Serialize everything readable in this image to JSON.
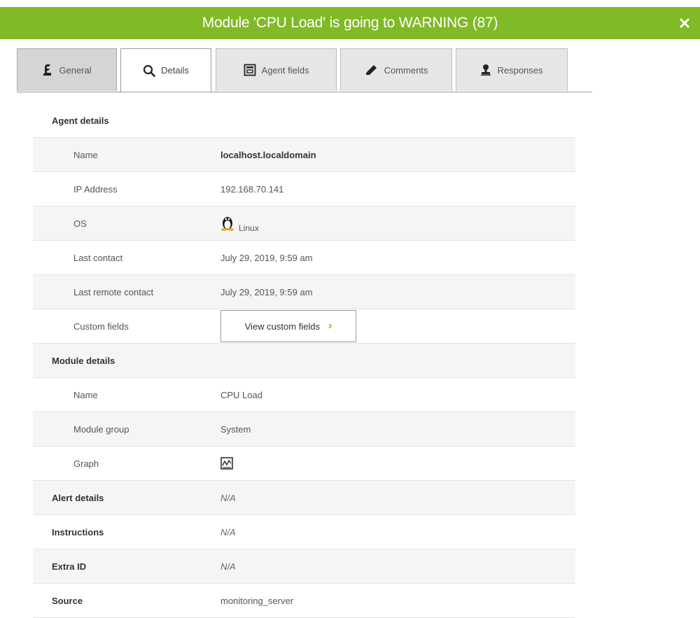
{
  "window": {
    "title": "Module 'CPU Load' is going to WARNING (87)",
    "accent_color": "#80ba27"
  },
  "tabs": [
    {
      "label": "General",
      "icon": "pandora-logo-icon"
    },
    {
      "label": "Details",
      "icon": "search-icon"
    },
    {
      "label": "Agent fields",
      "icon": "form-icon"
    },
    {
      "label": "Comments",
      "icon": "pencil-icon"
    },
    {
      "label": "Responses",
      "icon": "stamp-icon"
    }
  ],
  "active_tab": "Details",
  "agent_details": {
    "heading": "Agent details",
    "name_label": "Name",
    "name_value": "localhost.localdomain",
    "ip_label": "IP Address",
    "ip_value": "192.168.70.141",
    "os_label": "OS",
    "os_value": "Linux",
    "last_contact_label": "Last contact",
    "last_contact_value": "July 29, 2019, 9:59 am",
    "last_remote_label": "Last remote contact",
    "last_remote_value": "July 29, 2019, 9:59 am",
    "custom_fields_label": "Custom fields",
    "custom_fields_button": "View custom fields"
  },
  "module_details": {
    "heading": "Module details",
    "name_label": "Name",
    "name_value": "CPU Load",
    "group_label": "Module group",
    "group_value": "System",
    "graph_label": "Graph"
  },
  "alert_details": {
    "label": "Alert details",
    "value": "N/A"
  },
  "instructions": {
    "label": "Instructions",
    "value": "N/A"
  },
  "extra_id": {
    "label": "Extra ID",
    "value": "N/A"
  },
  "source": {
    "label": "Source",
    "value": "monitoring_server"
  }
}
